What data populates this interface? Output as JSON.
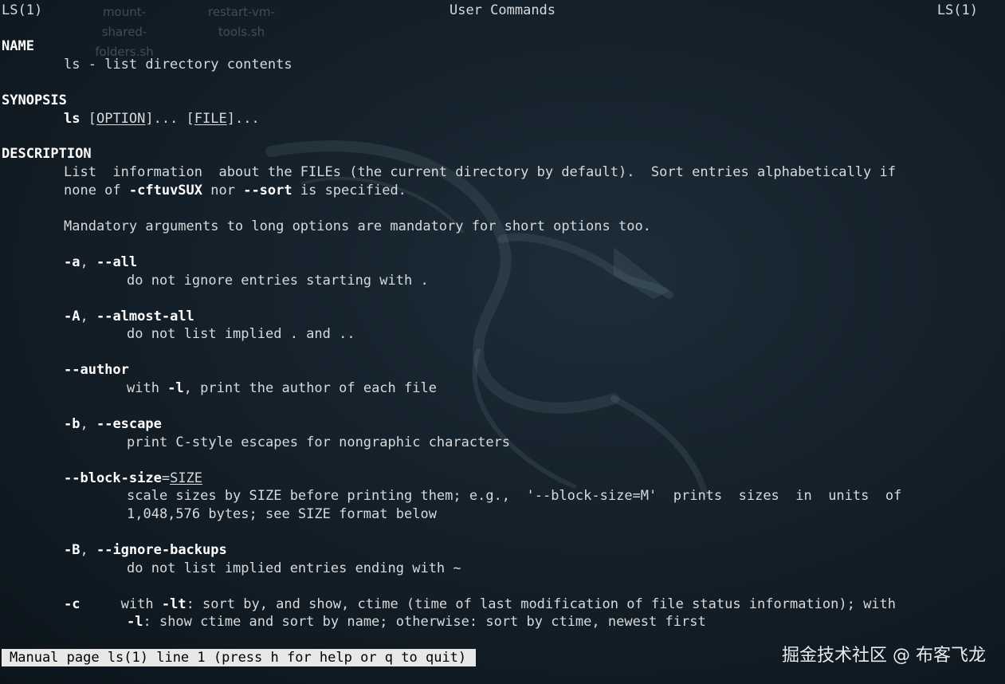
{
  "desktop": {
    "icons": [
      {
        "label_line1": "mount-",
        "label_line2": "shared-",
        "label_line3": "folders.sh"
      },
      {
        "label_line1": "restart-vm-",
        "label_line2": "tools.sh",
        "label_line3": ""
      }
    ]
  },
  "header": {
    "left": "LS(1)",
    "center": "User Commands",
    "right": "LS(1)"
  },
  "man": {
    "name_heading": "NAME",
    "name_text": "ls - list directory contents",
    "synopsis_heading": "SYNOPSIS",
    "synopsis_cmd": "ls",
    "synopsis_sp1": " [",
    "synopsis_option": "OPTION",
    "synopsis_mid": "]... [",
    "synopsis_file": "FILE",
    "synopsis_end": "]...",
    "description_heading": "DESCRIPTION",
    "desc_line1": "List  information  about the FILEs (the current directory by default).  Sort entries alphabetically if",
    "desc_line2_a": "none of ",
    "desc_line2_b": "-cftuvSUX",
    "desc_line2_c": " nor ",
    "desc_line2_d": "--sort",
    "desc_line2_e": " is specified.",
    "mandatory": "Mandatory arguments to long options are mandatory for short options too.",
    "opt_a_flag1": "-a",
    "opt_a_sep": ", ",
    "opt_a_flag2": "--all",
    "opt_a_desc": "do not ignore entries starting with .",
    "opt_A_flag1": "-A",
    "opt_A_sep": ", ",
    "opt_A_flag2": "--almost-all",
    "opt_A_desc": "do not list implied . and ..",
    "opt_author_flag": "--author",
    "opt_author_desc_a": "with ",
    "opt_author_desc_b": "-l",
    "opt_author_desc_c": ", print the author of each file",
    "opt_b_flag1": "-b",
    "opt_b_sep": ", ",
    "opt_b_flag2": "--escape",
    "opt_b_desc": "print C-style escapes for nongraphic characters",
    "opt_bs_flag": "--block-size",
    "opt_bs_eq": "=",
    "opt_bs_arg": "SIZE",
    "opt_bs_desc1": "scale sizes by SIZE before printing them; e.g.,  '--block-size=M'  prints  sizes  in  units  of",
    "opt_bs_desc2": "1,048,576 bytes; see SIZE format below",
    "opt_B_flag1": "-B",
    "opt_B_sep": ", ",
    "opt_B_flag2": "--ignore-backups",
    "opt_B_desc": "do not list implied entries ending with ~",
    "opt_c_flag": "-c",
    "opt_c_gap": "     ",
    "opt_c_desc1_a": "with ",
    "opt_c_desc1_b": "-lt",
    "opt_c_desc1_c": ": sort by, and show, ctime (time of last modification of file status information); with",
    "opt_c_desc2_a": "-l",
    "opt_c_desc2_b": ": show ctime and sort by name; otherwise: sort by ctime, newest first"
  },
  "status": {
    "text": "Manual page ls(1) line 1 (press h for help or q to quit)"
  },
  "watermark": {
    "text": "掘金技术社区 @ 布客飞龙"
  }
}
